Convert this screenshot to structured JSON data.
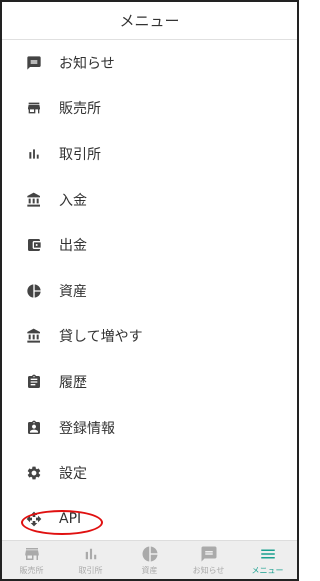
{
  "header": {
    "title": "メニュー"
  },
  "menu": {
    "items": [
      {
        "label": "お知らせ",
        "icon": "announcement-icon"
      },
      {
        "label": "販売所",
        "icon": "store-icon"
      },
      {
        "label": "取引所",
        "icon": "bar-chart-icon"
      },
      {
        "label": "入金",
        "icon": "bank-icon"
      },
      {
        "label": "出金",
        "icon": "wallet-icon"
      },
      {
        "label": "資産",
        "icon": "pie-chart-icon"
      },
      {
        "label": "貸して増やす",
        "icon": "bank-icon"
      },
      {
        "label": "履歴",
        "icon": "clipboard-icon"
      },
      {
        "label": "登録情報",
        "icon": "contact-card-icon"
      },
      {
        "label": "設定",
        "icon": "gear-icon"
      },
      {
        "label": "API",
        "icon": "move-arrows-icon"
      }
    ]
  },
  "bottom_nav": {
    "items": [
      {
        "label": "販売所",
        "icon": "store-icon",
        "active": false
      },
      {
        "label": "取引所",
        "icon": "bar-chart-icon",
        "active": false
      },
      {
        "label": "資産",
        "icon": "pie-chart-icon",
        "active": false
      },
      {
        "label": "お知らせ",
        "icon": "announcement-icon",
        "active": false
      },
      {
        "label": "メニュー",
        "icon": "hamburger-menu-icon",
        "active": true
      }
    ]
  },
  "colors": {
    "icon": "#444444",
    "nav_icon_inactive": "#aaaaaa",
    "accent": "#1aa08f",
    "highlight_oval": "#e01010"
  }
}
